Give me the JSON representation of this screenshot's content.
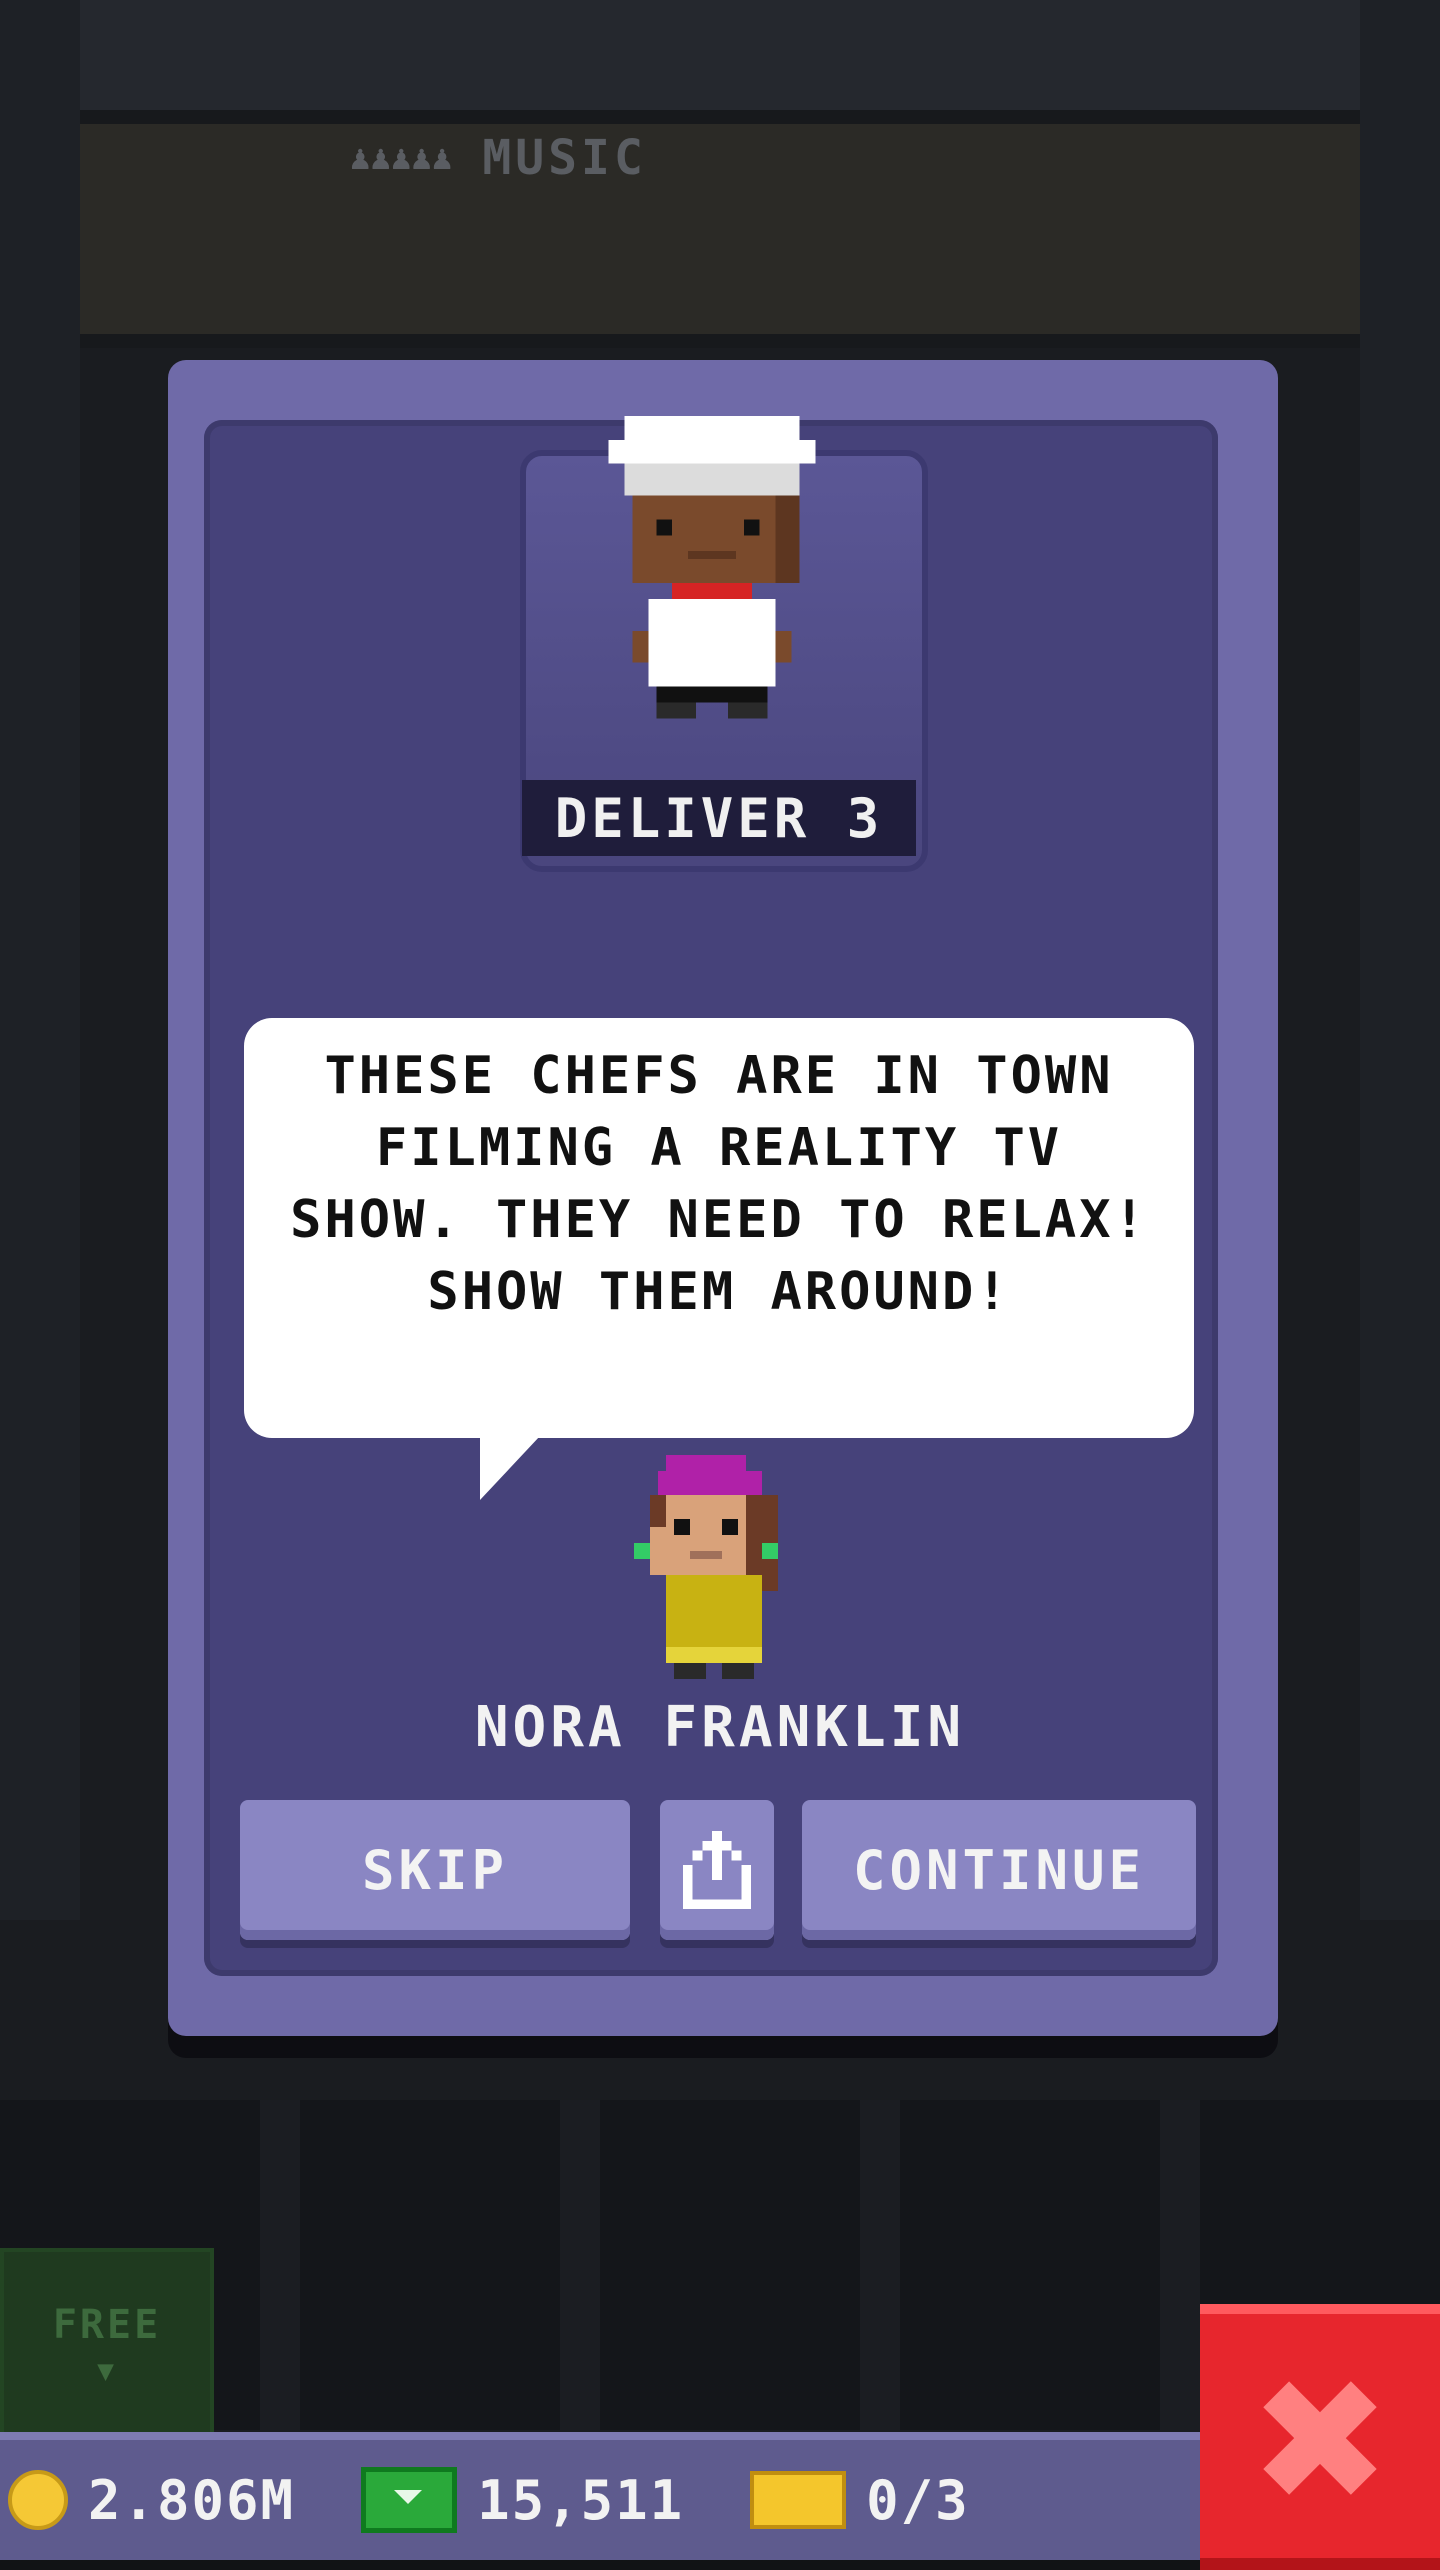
{
  "background": {
    "floor_label": "MUSIC",
    "floor_people_icons": "♟♟♟♟♟"
  },
  "free_button": {
    "label": "FREE"
  },
  "quest": {
    "deliver_label": "DELIVER 3",
    "speech": "THESE CHEFS ARE IN TOWN FILMING A REALITY TV SHOW. THEY NEED TO RELAX! SHOW THEM AROUND!",
    "npc_name": "NORA FRANKLIN"
  },
  "buttons": {
    "skip": "SKIP",
    "continue": "CONTINUE"
  },
  "status": {
    "coins": "2.806M",
    "cash": "15,511",
    "tickets": "0/3"
  },
  "colors": {
    "modal": "#6f6aa8",
    "accent_red": "#e7262d",
    "coin": "#f5c835",
    "cash": "#2aa93a"
  },
  "icons": {
    "share": "share-icon",
    "close": "close-icon"
  }
}
